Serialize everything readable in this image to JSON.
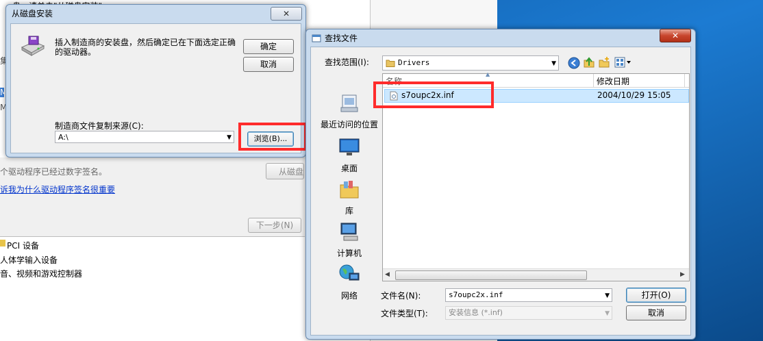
{
  "background": {
    "top_text": "盘，请单击\"从磁盘安装\"",
    "signed_text": "个驱动程序已经过数字签名。",
    "from_disk_button": "从磁盘",
    "why_link": "诉我为什么驱动程序签名很重要",
    "next_button": "下一步(N)",
    "left_fragments": [
      "集",
      "M",
      "M"
    ],
    "device_list": [
      "PCI 设备",
      "人体学输入设备",
      "音、视频和游戏控制器"
    ]
  },
  "install_dialog": {
    "title": "从磁盘安装",
    "close": "✕",
    "message": "插入制造商的安装盘，然后确定已在下面选定正确的驱动器。",
    "ok_button": "确定",
    "cancel_button": "取消",
    "source_label": "制造商文件复制来源(C):",
    "source_value": "A:\\",
    "browse_button": "浏览(B)..."
  },
  "find_dialog": {
    "title": "查找文件",
    "close": "✕",
    "look_in_label": "查找范围(I):",
    "look_in_value": "Drivers",
    "columns": {
      "name": "名称",
      "date": "修改日期"
    },
    "files": [
      {
        "name": "s7oupc2x.inf",
        "date": "2004/10/29 15:05"
      }
    ],
    "places": [
      {
        "label": "最近访问的位置",
        "icon": "recent-places-icon"
      },
      {
        "label": "桌面",
        "icon": "desktop-icon"
      },
      {
        "label": "库",
        "icon": "libraries-icon"
      },
      {
        "label": "计算机",
        "icon": "computer-icon"
      },
      {
        "label": "网络",
        "icon": "network-icon"
      }
    ],
    "filename_label": "文件名(N):",
    "filename_value": "s7oupc2x.inf",
    "filetype_label": "文件类型(T):",
    "filetype_value": "安装信息 (*.inf)",
    "open_button": "打开(O)",
    "cancel_button": "取消"
  }
}
